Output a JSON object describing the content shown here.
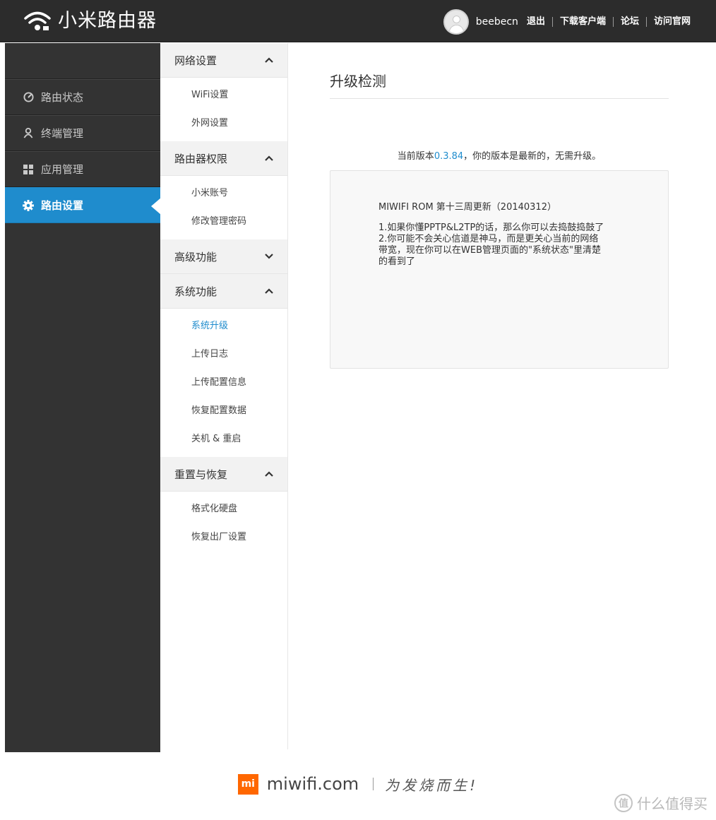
{
  "header": {
    "app_title": "小米路由器",
    "username": "beebecn",
    "links": [
      "退出",
      "下载客户端",
      "论坛",
      "访问官网"
    ]
  },
  "sidebar": {
    "items": [
      {
        "label": "路由状态",
        "icon": "gauge-icon"
      },
      {
        "label": "终端管理",
        "icon": "user-icon"
      },
      {
        "label": "应用管理",
        "icon": "apps-grid-icon"
      },
      {
        "label": "路由设置",
        "icon": "gear-icon",
        "active": true
      }
    ]
  },
  "submenu": {
    "groups": [
      {
        "title": "网络设置",
        "expanded": true,
        "items": [
          "WiFi设置",
          "外网设置"
        ]
      },
      {
        "title": "路由器权限",
        "expanded": true,
        "items": [
          "小米账号",
          "修改管理密码"
        ]
      },
      {
        "title": "高级功能",
        "expanded": false,
        "items": []
      },
      {
        "title": "系统功能",
        "expanded": true,
        "items": [
          "系统升级",
          "上传日志",
          "上传配置信息",
          "恢复配置数据",
          "关机 & 重启"
        ]
      },
      {
        "title": "重置与恢复",
        "expanded": true,
        "items": [
          "格式化硬盘",
          "恢复出厂设置"
        ]
      }
    ],
    "active_item": "系统升级"
  },
  "main": {
    "title": "升级检测",
    "version_prefix": "当前版本",
    "version": "0.3.84",
    "version_suffix": "，你的版本是最新的，无需升级。",
    "notes_title": "MIWIFI ROM 第十三周更新（20140312）",
    "notes": [
      "1.如果你懂PPTP&L2TP的话，那么你可以去捣鼓捣鼓了",
      "2.你可能不会关心信道是神马，而是更关心当前的网络",
      "带宽，现在你可以在WEB管理页面的\"系统状态\"里清楚",
      "的看到了"
    ]
  },
  "footer": {
    "badge": "mi",
    "domain": "miwifi.com",
    "slogan": "为发烧而生!"
  },
  "watermark": {
    "text": "什么值得买",
    "icon_glyph": "值"
  },
  "colors": {
    "accent": "#1f8ccd",
    "topbar": "#2c2c2c",
    "sidebar": "#333333",
    "brand_orange": "#ff6700"
  }
}
